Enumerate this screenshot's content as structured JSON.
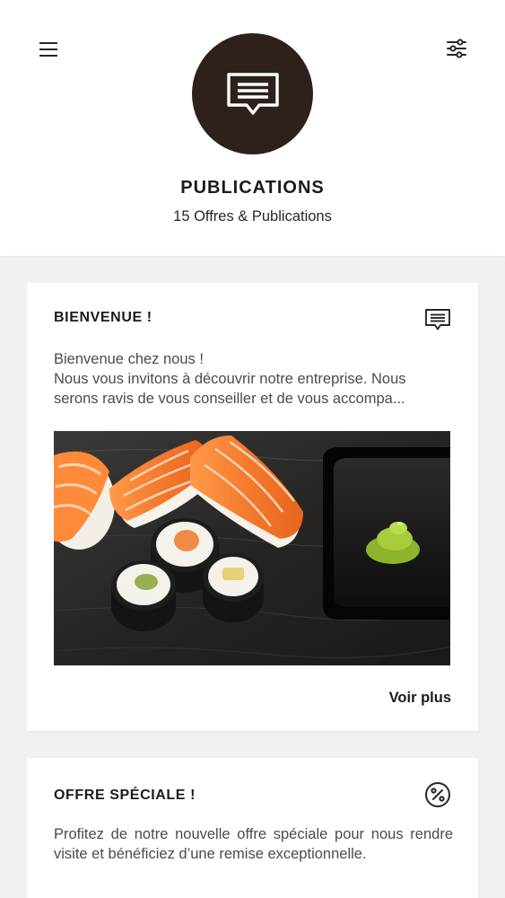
{
  "header": {
    "title": "PUBLICATIONS",
    "subtitle": "15 Offres & Publications",
    "menu_icon": "hamburger-menu-icon",
    "filter_icon": "sliders-filter-icon",
    "avatar_icon": "message-square-icon",
    "avatar_color": "#2e211c"
  },
  "posts": [
    {
      "title": "BIENVENUE !",
      "icon": "message-square-icon",
      "text_line1": "Bienvenue chez nous !",
      "text_line2": "Nous vous invitons à découvrir notre entreprise. Nous serons ravis de vous conseiller et de vous accompa...",
      "image_icon": "sushi-photo",
      "more_label": "Voir plus"
    },
    {
      "title": "OFFRE SPÉCIALE !",
      "icon": "percent-circle-icon",
      "text": "Profitez de notre nouvelle offre spéciale pour nous rendre visite et bénéficiez d’une remise exceptionnelle."
    }
  ],
  "colors": {
    "background": "#f1f0f2",
    "card": "#ffffff",
    "text_dark": "#1f1a18",
    "text_body": "#4f4a48"
  }
}
